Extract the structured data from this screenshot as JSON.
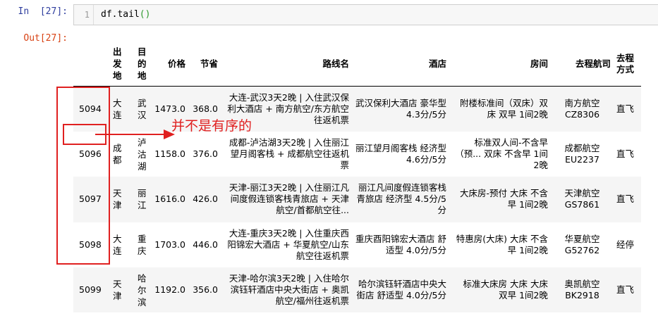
{
  "input_cell": {
    "prompt": "In  [27]:",
    "line_number": "1",
    "code": "df.tail",
    "code_parens": "()"
  },
  "output_cell": {
    "prompt": "Out[27]:"
  },
  "table": {
    "columns": [
      "",
      "出发地",
      "目的地",
      "价格",
      "节省",
      "路线名",
      "酒店",
      "房间",
      "去程航司",
      "去程方式"
    ],
    "rows": [
      {
        "index": "5094",
        "from": "大连",
        "to": "武汉",
        "price": "1473.0",
        "save": "368.0",
        "route": "大连-武汉3天2晚 | 入住武汉保利大酒店 + 南方航空/东方航空往返机票",
        "hotel": "武汉保利大酒店 豪华型 4.3分/5分",
        "room": "附楼标准间（双床）双床 双早 1间2晚",
        "airline": "南方航空 CZ8306",
        "method": "直飞"
      },
      {
        "index": "5096",
        "from": "成都",
        "to": "泸沽湖",
        "price": "1158.0",
        "save": "376.0",
        "route": "成都-泸沽湖3天2晚 | 入住丽江望月阁客栈 + 成都航空往返机票",
        "hotel": "丽江望月阁客栈 经济型 4.6分/5分",
        "room": "标准双人间-不含早（预... 双床 不含早 1间2晚",
        "airline": "成都航空 EU2237",
        "method": "直飞"
      },
      {
        "index": "5097",
        "from": "天津",
        "to": "丽江",
        "price": "1616.0",
        "save": "426.0",
        "route": "天津-丽江3天2晚 | 入住丽江凡间度假连锁客栈青旅店 + 天津航空/首都航空往...",
        "hotel": "丽江凡间度假连锁客栈青旅店 经济型 4.5分/5分",
        "room": "大床房-预付 大床 不含早 1间2晚",
        "airline": "天津航空 GS7861",
        "method": "直飞"
      },
      {
        "index": "5098",
        "from": "大连",
        "to": "重庆",
        "price": "1703.0",
        "save": "446.0",
        "route": "大连-重庆3天2晚 | 入住重庆西阳锦宏大酒店 + 华夏航空/山东航空往返机票",
        "hotel": "重庆酉阳锦宏大酒店 舒适型 4.0分/5分",
        "room": "特惠房(大床) 大床 不含早 1间2晚",
        "airline": "华夏航空 G52762",
        "method": "经停"
      },
      {
        "index": "5099",
        "from": "天津",
        "to": "哈尔滨",
        "price": "1192.0",
        "save": "356.0",
        "route": "天津-哈尔滨3天2晚 | 入住哈尔滨钰轩酒店中央大街店 + 奥凯航空/福州往返机票",
        "hotel": "哈尔滨钰轩酒店中央大街店 舒适型 4.0分/5分",
        "room": "标准大床房 大床 大床 双早 1间2晚",
        "airline": "奥凯航空 BK2918",
        "method": "直飞"
      }
    ]
  },
  "annotation": {
    "text": "并不是有序的",
    "color": "#e02020"
  }
}
